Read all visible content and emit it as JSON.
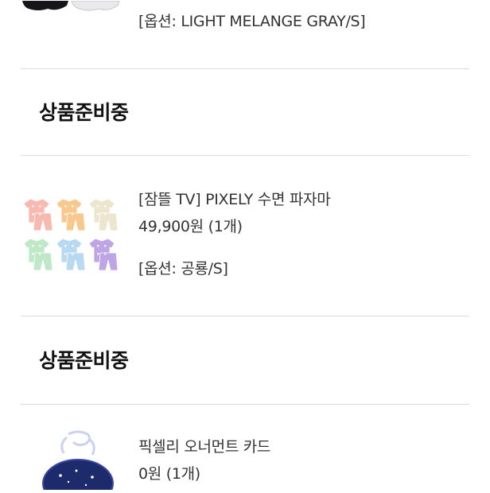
{
  "order_items": [
    {
      "option": "[옵션: LIGHT MELANGE GRAY/S]"
    },
    {
      "status": "상품준비중",
      "name": "[잠뜰 TV] PIXELY 수면 파자마",
      "price_qty": "49,900원 (1개)",
      "option": "[옵션: 공룡/S]",
      "pajama_colors": [
        "#f7b9b0",
        "#f8c98e",
        "#ece6cf",
        "#bfe8c8",
        "#b9d8f2",
        "#bfa4e6"
      ]
    },
    {
      "status": "상품준비중",
      "name": "픽셀리 오너먼트 카드",
      "price_qty": "0원 (1개)"
    }
  ],
  "colors": {
    "divider": "#dcdcdc",
    "title": "#111111",
    "text": "#333333"
  }
}
